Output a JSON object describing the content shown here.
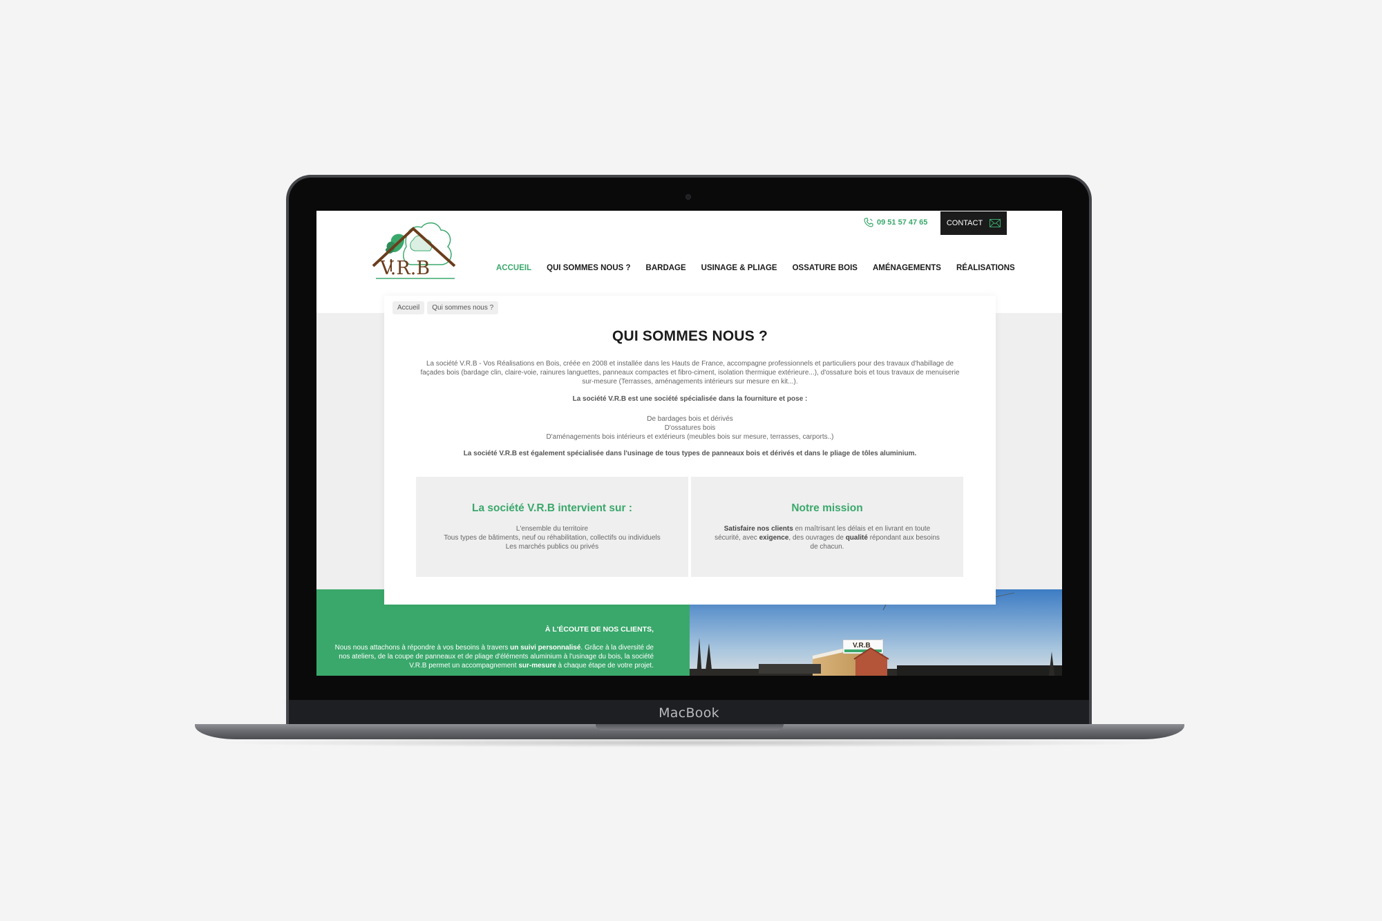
{
  "device": {
    "brand_label": "MacBook"
  },
  "header": {
    "logo_text": "V.R.B",
    "phone": "09 51 57 47 65",
    "contact_label": "CONTACT"
  },
  "nav": {
    "items": [
      "ACCUEIL",
      "QUI SOMMES NOUS ?",
      "BARDAGE",
      "USINAGE & PLIAGE",
      "OSSATURE BOIS",
      "AMÉNAGEMENTS",
      "RÉALISATIONS"
    ],
    "active": "ACCUEIL"
  },
  "breadcrumb": [
    "Accueil",
    "Qui sommes nous ?"
  ],
  "page": {
    "title": "QUI SOMMES NOUS ?",
    "intro": "La société V.R.B - Vos Réalisations en Bois, créée en 2008 et installée dans les Hauts de France, accompagne professionnels et particuliers pour des travaux d'habillage de façades bois (bardage clin, claire-voie, rainures languettes, panneaux compactes et fibro-ciment, isolation thermique extérieure...), d'ossature bois et tous travaux de menuiserie sur-mesure (Terrasses, aménagements intérieurs sur mesure en kit...).",
    "specialty_heading": "La société V.R.B est une société spécialisée dans la fourniture et pose :",
    "specialties": [
      "De bardages bois et dérivés",
      "D'ossatures bois",
      "D'aménagements bois intérieurs et extérieurs (meubles bois sur mesure, terrasses, carports..)"
    ],
    "extra_specialty": "La société V.R.B est également spécialisée dans l'usinage de tous types de panneaux bois et dérivés et dans le pliage de tôles aluminium."
  },
  "boxes": {
    "intervention": {
      "title": "La société V.R.B intervient sur :",
      "lines": [
        "L'ensemble du territoire",
        "Tous types de bâtiments, neuf ou réhabilitation, collectifs ou individuels",
        "Les marchés publics ou privés"
      ]
    },
    "mission": {
      "title": "Notre mission",
      "bold_1": "Satisfaire nos clients",
      "text_1": " en maîtrisant les délais et en livrant en toute sécurité, avec ",
      "bold_2": "exigence",
      "text_2": ", des ouvrages de ",
      "bold_3": "qualité",
      "text_3": " répondant aux besoins de chacun."
    }
  },
  "listen": {
    "title": "À L'ÉCOUTE DE NOS CLIENTS,",
    "text_1": "Nous nous attachons à répondre à vos besoins à travers ",
    "bold_1": "un suivi personnalisé",
    "text_2": ". Grâce à la diversité de nos ateliers, de la coupe de panneaux et de pliage d'éléments aluminium à l'usinage du bois, la société V.R.B permet un accompagnement ",
    "bold_2": "sur-mesure",
    "text_3": " à chaque étape de votre projet."
  },
  "photo": {
    "sign_text": "V.R.B"
  },
  "colors": {
    "accent_green": "#3aa86b",
    "dark": "#1b1b1b",
    "panel_grey": "#efefef"
  },
  "icons": [
    "phone-icon",
    "envelope-icon"
  ]
}
